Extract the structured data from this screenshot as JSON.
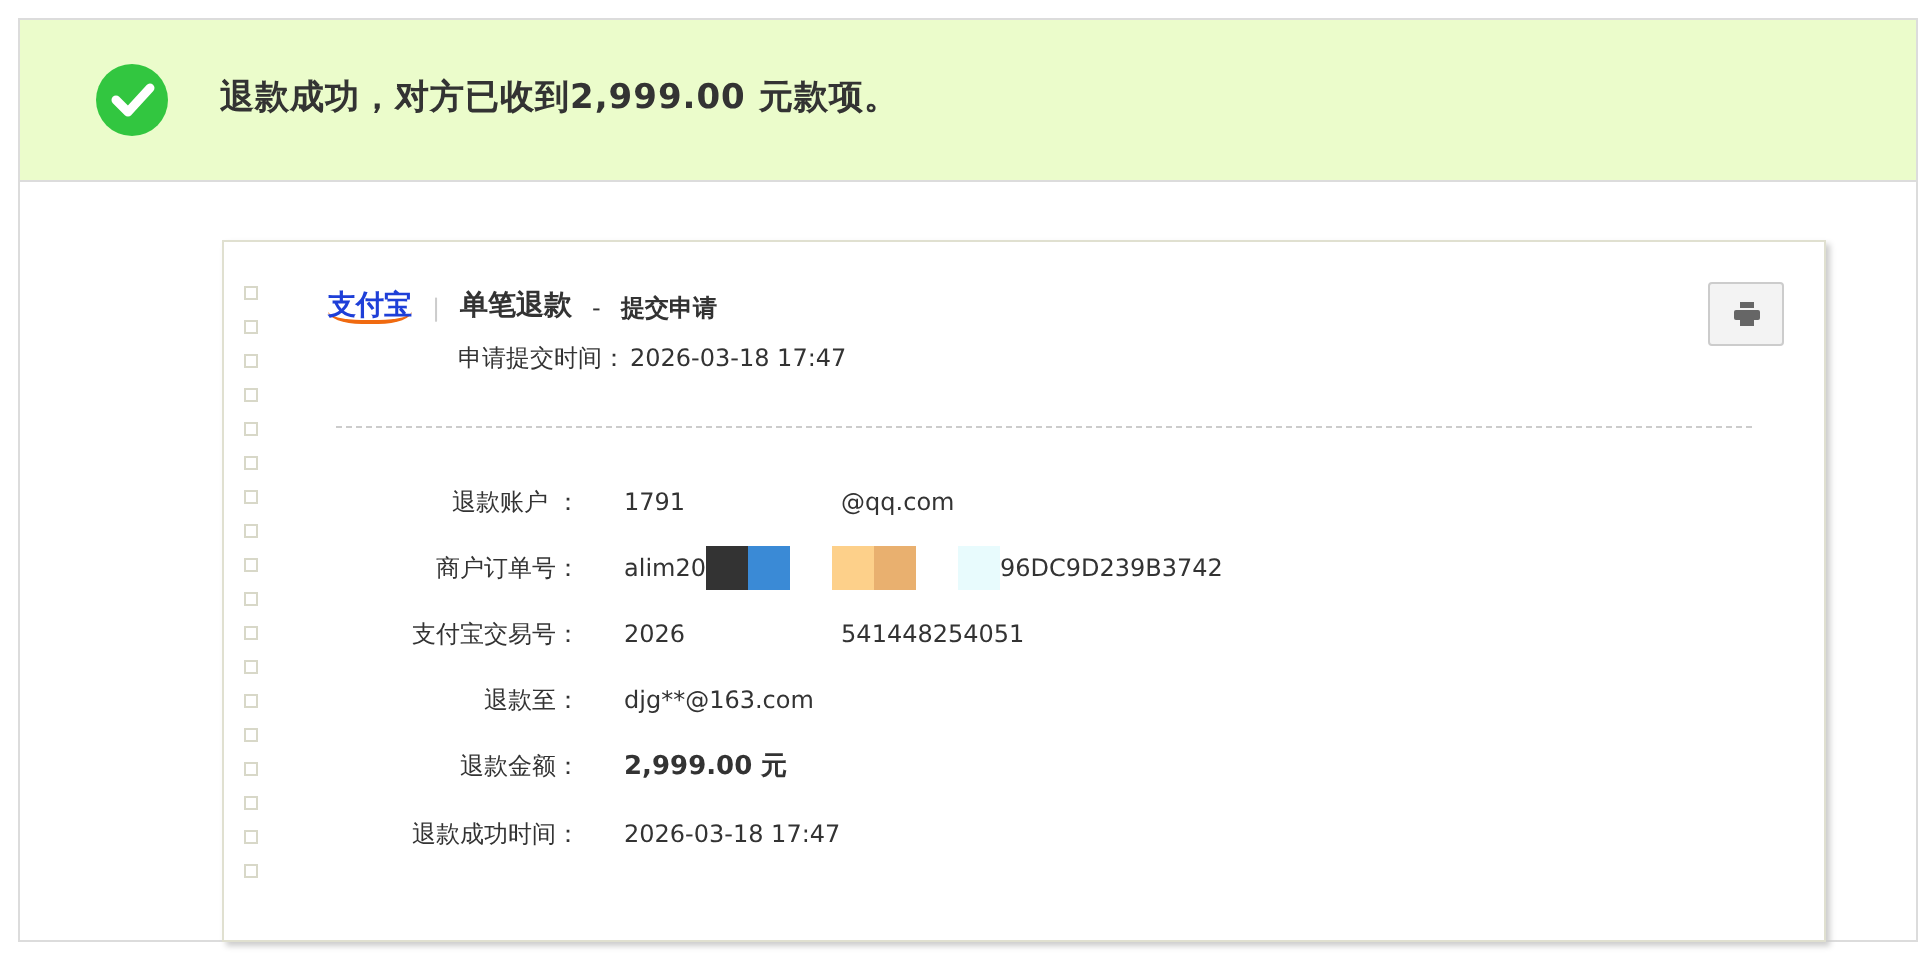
{
  "banner": {
    "text": "退款成功，对方已收到**2,999.00** 元款项。"
  },
  "receipt": {
    "logo": "支付宝",
    "divider": "|",
    "title": "单笔退款",
    "separator": "-",
    "subtitle": "提交申请",
    "time_label": "申请提交时间：",
    "time_value": "2026-03-18 17:47",
    "rows": [
      {
        "label": "退款账户 ：",
        "kind": "masked",
        "parts": [
          "1791",
          "@qq.com"
        ],
        "masks": []
      },
      {
        "label": "商户订单号：",
        "kind": "masked",
        "parts": [
          "alim20",
          "96DC9D239B3742"
        ],
        "masks": [
          {
            "kind": "block",
            "color": "#333333"
          },
          {
            "kind": "block",
            "color": "#3a8ad6"
          },
          {
            "kind": "gap"
          },
          {
            "kind": "block",
            "color": "#fdd08a"
          },
          {
            "kind": "block",
            "color": "#e9b06f"
          },
          {
            "kind": "gap"
          },
          {
            "kind": "block",
            "color": "#e8fbfd"
          }
        ]
      },
      {
        "label": "支付宝交易号：",
        "kind": "masked",
        "parts": [
          "2026",
          "541448254051"
        ],
        "masks": []
      },
      {
        "label": "退款至：",
        "kind": "plain",
        "parts": [
          "djg**@163.com"
        ],
        "masks": []
      },
      {
        "label": "退款金额：",
        "kind": "amount",
        "parts": [
          "2,999.00 元"
        ],
        "masks": []
      },
      {
        "label": "退款成功时间：",
        "kind": "plain",
        "parts": [
          "2026-03-18 17:47"
        ],
        "masks": []
      }
    ]
  }
}
